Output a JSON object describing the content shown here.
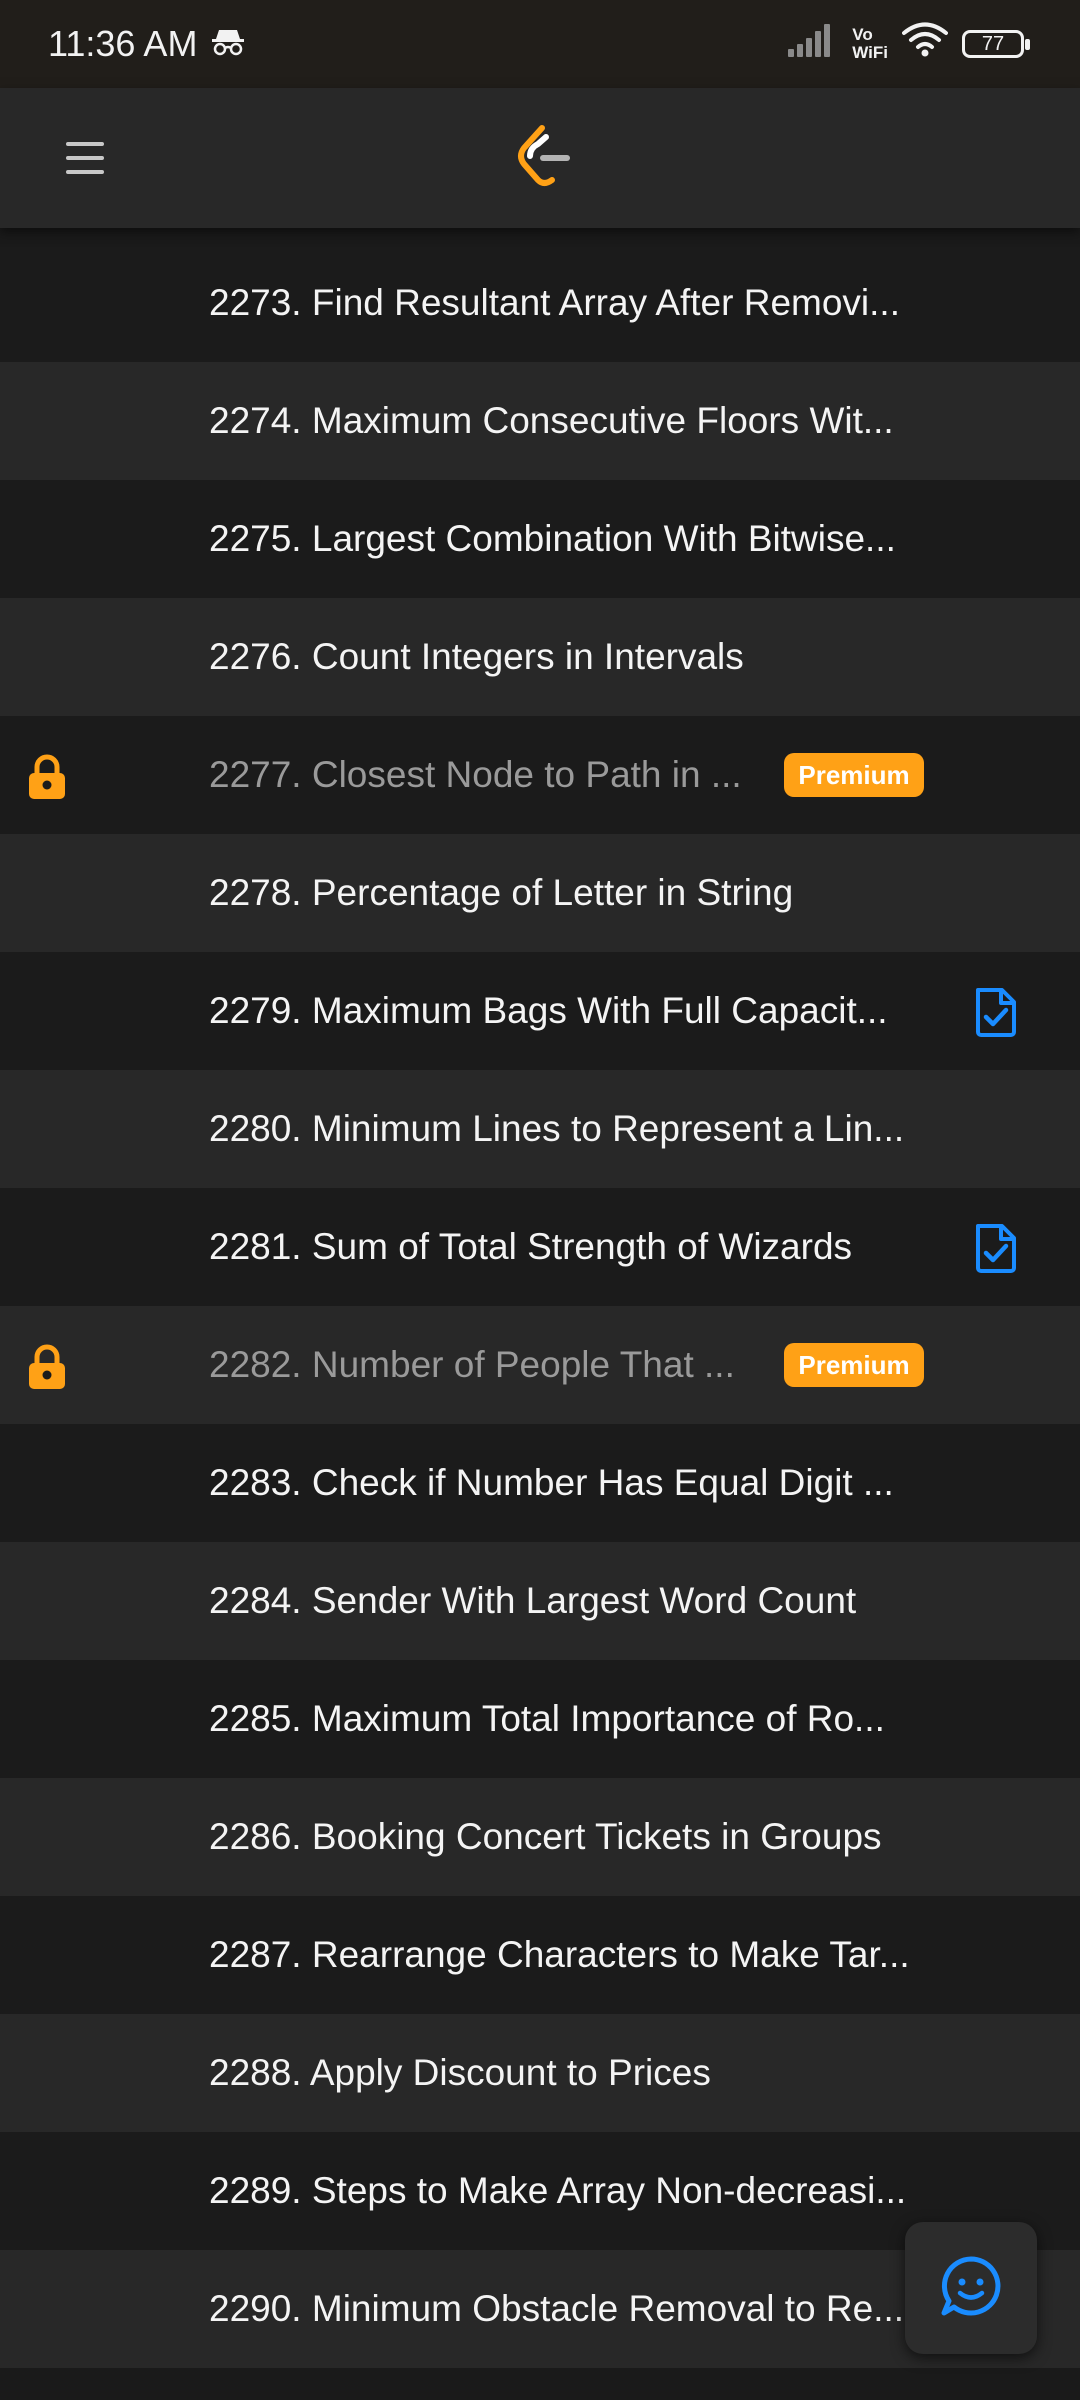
{
  "status_bar": {
    "time": "11:36 AM",
    "network_label_top": "Vo",
    "network_label_bottom": "WiFi",
    "battery_level": "77",
    "icons": [
      "incognito-icon",
      "signal-icon",
      "wifi-icon",
      "battery-icon"
    ]
  },
  "app_bar": {
    "menu_icon": "hamburger-menu-icon",
    "logo_icon": "leetcode-logo-icon"
  },
  "problems": [
    {
      "title": "2273. Find Resultant Array After Removi...",
      "locked": false,
      "premium_label": "",
      "solved": false
    },
    {
      "title": "2274. Maximum Consecutive Floors Wit...",
      "locked": false,
      "premium_label": "",
      "solved": false
    },
    {
      "title": "2275. Largest Combination With Bitwise...",
      "locked": false,
      "premium_label": "",
      "solved": false
    },
    {
      "title": "2276. Count Integers in Intervals",
      "locked": false,
      "premium_label": "",
      "solved": false
    },
    {
      "title": "2277. Closest Node to Path in ...",
      "locked": true,
      "premium_label": "Premium",
      "solved": false
    },
    {
      "title": "2278. Percentage of Letter in String",
      "locked": false,
      "premium_label": "",
      "solved": false
    },
    {
      "title": "2279. Maximum Bags With Full Capacit...",
      "locked": false,
      "premium_label": "",
      "solved": true
    },
    {
      "title": "2280. Minimum Lines to Represent a Lin...",
      "locked": false,
      "premium_label": "",
      "solved": false
    },
    {
      "title": "2281. Sum of Total Strength of Wizards",
      "locked": false,
      "premium_label": "",
      "solved": true
    },
    {
      "title": "2282. Number of People That ...",
      "locked": true,
      "premium_label": "Premium",
      "solved": false
    },
    {
      "title": "2283. Check if Number Has Equal Digit ...",
      "locked": false,
      "premium_label": "",
      "solved": false
    },
    {
      "title": "2284. Sender With Largest Word Count",
      "locked": false,
      "premium_label": "",
      "solved": false
    },
    {
      "title": "2285. Maximum Total Importance of Ro...",
      "locked": false,
      "premium_label": "",
      "solved": false
    },
    {
      "title": "2286. Booking Concert Tickets in Groups",
      "locked": false,
      "premium_label": "",
      "solved": false
    },
    {
      "title": "2287. Rearrange Characters to Make Tar...",
      "locked": false,
      "premium_label": "",
      "solved": false
    },
    {
      "title": "2288. Apply Discount to Prices",
      "locked": false,
      "premium_label": "",
      "solved": false
    },
    {
      "title": "2289. Steps to Make Array Non-decreasi...",
      "locked": false,
      "premium_label": "",
      "solved": false
    },
    {
      "title": "2290. Minimum Obstacle Removal to Re...",
      "locked": false,
      "premium_label": "",
      "solved": false
    }
  ],
  "fab": {
    "icon": "feedback-chat-icon"
  },
  "colors": {
    "accent": "#ffa116",
    "solved": "#1a8cff",
    "row_dark": "#1b1b1b",
    "row_light": "#282828"
  }
}
